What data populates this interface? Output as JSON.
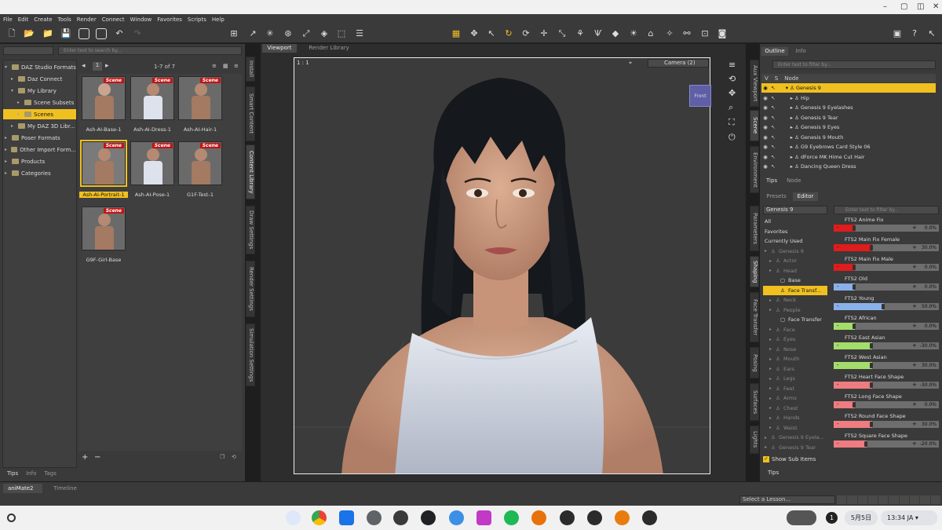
{
  "menubar": [
    "File",
    "Edit",
    "Create",
    "Tools",
    "Render",
    "Connect",
    "Window",
    "Favorites",
    "Scripts",
    "Help"
  ],
  "content_library": {
    "search_placeholder": "Enter text to search by...",
    "page_indicator": "1",
    "count": "1-7 of 7",
    "tree": [
      {
        "label": "DAZ Studio Formats",
        "indent": 0,
        "expanded": true
      },
      {
        "label": "Daz Connect",
        "indent": 1
      },
      {
        "label": "My Library",
        "indent": 1,
        "expanded": true
      },
      {
        "label": "Scene Subsets",
        "indent": 2
      },
      {
        "label": "Scenes",
        "indent": 2,
        "selected": true
      },
      {
        "label": "My DAZ 3D Libr...",
        "indent": 1
      },
      {
        "label": "Poser Formats",
        "indent": 0
      },
      {
        "label": "Other Import Form...",
        "indent": 0
      },
      {
        "label": "Products",
        "indent": 0
      },
      {
        "label": "Categories",
        "indent": 0
      }
    ],
    "tag": "Scene",
    "items": [
      {
        "label": "Ash-AI-Base-1"
      },
      {
        "label": "Ash-AI-Dress-1"
      },
      {
        "label": "Ash-AI-Hair-1"
      },
      {
        "label": "Ash-AI-Portrait-1",
        "selected": true
      },
      {
        "label": "Ash-AI-Pose-1"
      },
      {
        "label": "G1F-Test-1"
      },
      {
        "label": "G9F-Girl-Base"
      }
    ],
    "bottom_tabs": [
      "Tips",
      "Info",
      "Tags"
    ],
    "side_tabs": [
      "Install",
      "Smart Content",
      "Content Library",
      "Draw Settings",
      "Render Settings",
      "Simulation Settings"
    ]
  },
  "viewport": {
    "tabs": [
      "Viewport",
      "Render Library"
    ],
    "ratio": "1 : 1",
    "camera": "Camera (2)",
    "cube_label": "Front"
  },
  "outline": {
    "tabs": [
      "Outline",
      "Info"
    ],
    "search_placeholder": "Enter text to filter by...",
    "header": [
      "V",
      "S",
      "Node"
    ],
    "rows": [
      {
        "label": "Genesis 9",
        "selected": true,
        "indent": 0
      },
      {
        "label": "Hip",
        "indent": 1
      },
      {
        "label": "Genesis 9 Eyelashes",
        "indent": 1
      },
      {
        "label": "Genesis 9 Tear",
        "indent": 1
      },
      {
        "label": "Genesis 9 Eyes",
        "indent": 1
      },
      {
        "label": "Genesis 9 Mouth",
        "indent": 1
      },
      {
        "label": "G9 Eyebrows Card Style 06",
        "indent": 1
      },
      {
        "label": "dForce MK Hime Cut Hair",
        "indent": 1
      },
      {
        "label": "Dancing Queen Dress",
        "indent": 1
      }
    ],
    "bottom_tabs": [
      "Tips",
      "Node"
    ],
    "side_tabs": [
      "Aux Viewport",
      "Scene",
      "Environment"
    ]
  },
  "shaping": {
    "tabs": [
      "Presets",
      "Editor"
    ],
    "figure_select": "Genesis 9",
    "search_placeholder": "Enter text to filter by...",
    "categories": [
      {
        "label": "All"
      },
      {
        "label": "Favorites"
      },
      {
        "label": "Currently Used"
      },
      {
        "label": "Genesis 9",
        "dim": true
      },
      {
        "label": "Actor",
        "dim": true
      },
      {
        "label": "Head",
        "dim": true
      },
      {
        "label": "Base"
      },
      {
        "label": "Face Transf...",
        "selected": true
      },
      {
        "label": "Neck",
        "dim": true
      },
      {
        "label": "People",
        "dim": true
      },
      {
        "label": "Face Transfer"
      },
      {
        "label": "Face",
        "dim": true
      },
      {
        "label": "Eyes",
        "dim": true
      },
      {
        "label": "Nose",
        "dim": true
      },
      {
        "label": "Mouth",
        "dim": true
      },
      {
        "label": "Ears",
        "dim": true
      },
      {
        "label": "Legs",
        "dim": true
      },
      {
        "label": "Feet",
        "dim": true
      },
      {
        "label": "Arms",
        "dim": true
      },
      {
        "label": "Chest",
        "dim": true
      },
      {
        "label": "Hands",
        "dim": true
      },
      {
        "label": "Waist",
        "dim": true
      },
      {
        "label": "Genesis 9 Eyela...",
        "dim": true
      },
      {
        "label": "Genesis 9 Tear",
        "dim": true
      }
    ],
    "show_sub_items": "Show Sub Items",
    "params": [
      {
        "label": "FTS2 Anime Fix",
        "value": "0.0%",
        "pct": 0,
        "color": "#e01c1c"
      },
      {
        "label": "FTS2 Main Fix Female",
        "value": "30.0%",
        "pct": 0.3,
        "color": "#e01c1c"
      },
      {
        "label": "FTS2 Main Fix Male",
        "value": "0.0%",
        "pct": 0,
        "color": "#e01c1c"
      },
      {
        "label": "FTS2 Old",
        "value": "0.0%",
        "pct": 0,
        "color": "#8ab0ea"
      },
      {
        "label": "FTS2 Young",
        "value": "50.0%",
        "pct": 0.5,
        "color": "#8ab0ea"
      },
      {
        "label": "FTS2 African",
        "value": "0.0%",
        "pct": 0,
        "color": "#a4dd6c"
      },
      {
        "label": "FTS2 East Asian",
        "value": "-30.0%",
        "pct": -0.3,
        "color": "#a4dd6c"
      },
      {
        "label": "FTS2 West Asian",
        "value": "30.0%",
        "pct": 0.3,
        "color": "#a4dd6c"
      },
      {
        "label": "FTS2 Heart Face Shape",
        "value": "-30.0%",
        "pct": -0.3,
        "color": "#ee7c80"
      },
      {
        "label": "FTS2 Long Face Shape",
        "value": "0.0%",
        "pct": 0,
        "color": "#ee7c80"
      },
      {
        "label": "FTS2 Round Face Shape",
        "value": "30.0%",
        "pct": 0.3,
        "color": "#ee7c80"
      },
      {
        "label": "FTS2 Square Face Shape",
        "value": "-20.0%",
        "pct": -0.2,
        "color": "#ee7c80"
      }
    ],
    "side_tabs": [
      "Parameters",
      "Shaping",
      "Face Transfer",
      "Posing",
      "Surfaces",
      "Lights"
    ],
    "bottom_tab": "Tips"
  },
  "bottom": {
    "tabs": [
      "aniMate2",
      "Timeline"
    ],
    "lesson": "Select a Lesson..."
  },
  "taskbar": {
    "notif": "1",
    "date": "5月5日",
    "time": "13:34",
    "ime": "JA"
  }
}
